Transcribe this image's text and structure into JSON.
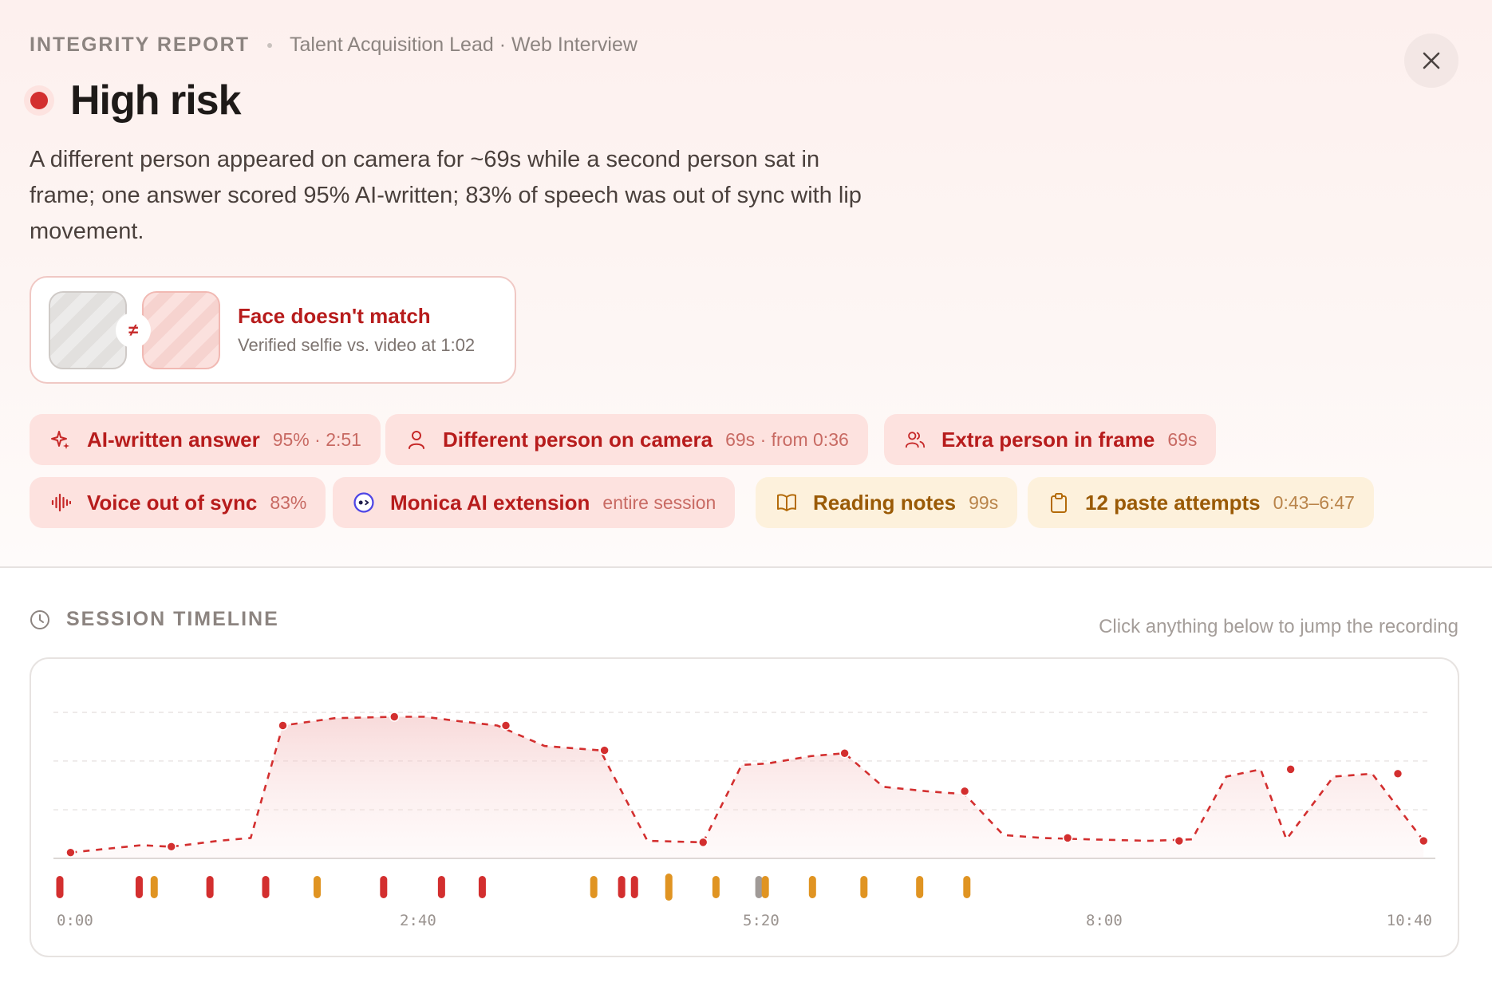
{
  "header": {
    "kicker": "INTEGRITY REPORT",
    "context": "Talent Acquisition Lead · Web Interview",
    "close_icon": "close-icon"
  },
  "risk": {
    "level": "High risk",
    "color": "#d32f2f",
    "summary": "A different person appeared on camera for ~69s while a second person sat in frame; one answer scored 95% AI-written; 83% of speech was out of sync with lip movement."
  },
  "face_match": {
    "title": "Face doesn't match",
    "subtitle": "Verified selfie vs. video at 1:02",
    "symbol": "≠"
  },
  "flags": [
    {
      "label": "AI-written answer",
      "meta": "95% · 2:51",
      "severity": "red",
      "icon": "sparkle-icon"
    },
    {
      "label": "Different person on camera",
      "meta": "69s · from 0:36",
      "severity": "red",
      "icon": "person-icon"
    },
    {
      "label": "Extra person in frame",
      "meta": "69s",
      "severity": "red",
      "icon": "people-icon"
    },
    {
      "label": "Voice out of sync",
      "meta": "83%",
      "severity": "red",
      "icon": "waveform-icon"
    },
    {
      "label": "Monica AI extension",
      "meta": "entire session",
      "severity": "red",
      "icon": "monica-icon"
    },
    {
      "label": "Reading notes",
      "meta": "99s",
      "severity": "amber",
      "icon": "book-icon"
    },
    {
      "label": "12 paste attempts",
      "meta": "0:43–6:47",
      "severity": "amber",
      "icon": "clipboard-icon"
    }
  ],
  "timeline": {
    "title": "SESSION TIMELINE",
    "hint": "Click anything below to jump the recording",
    "icon": "clock-icon"
  },
  "chart_data": {
    "type": "area",
    "x_unit": "seconds",
    "xlim": [
      0,
      640
    ],
    "ylim": [
      0,
      100
    ],
    "x_ticks": [
      {
        "value": 0,
        "label": "0:00"
      },
      {
        "value": 160,
        "label": "2:40"
      },
      {
        "value": 320,
        "label": "5:20"
      },
      {
        "value": 480,
        "label": "8:00"
      },
      {
        "value": 640,
        "label": "10:40"
      }
    ],
    "grid": true,
    "series": [
      {
        "color": "#d32f2f",
        "line_style": "dashed",
        "points": [
          [
            5,
            4
          ],
          [
            38,
            9
          ],
          [
            52,
            8
          ],
          [
            74,
            12
          ],
          [
            89,
            14
          ],
          [
            104,
            91
          ],
          [
            128,
            96
          ],
          [
            156,
            97
          ],
          [
            170,
            97
          ],
          [
            186,
            94
          ],
          [
            204,
            91
          ],
          [
            226,
            77
          ],
          [
            252,
            74
          ],
          [
            274,
            12
          ],
          [
            300,
            11
          ],
          [
            318,
            64
          ],
          [
            330,
            65
          ],
          [
            350,
            70
          ],
          [
            366,
            72
          ],
          [
            384,
            49
          ],
          [
            404,
            46
          ],
          [
            422,
            44
          ],
          [
            440,
            16
          ],
          [
            458,
            14
          ],
          [
            480,
            13
          ],
          [
            508,
            12
          ],
          [
            528,
            13
          ],
          [
            544,
            56
          ],
          [
            560,
            61
          ],
          [
            572,
            13
          ],
          [
            594,
            56
          ],
          [
            612,
            58
          ],
          [
            636,
            12
          ]
        ],
        "markers": [
          [
            5,
            4
          ],
          [
            52,
            8
          ],
          [
            104,
            91
          ],
          [
            156,
            97
          ],
          [
            208,
            91
          ],
          [
            254,
            74
          ],
          [
            300,
            11
          ],
          [
            366,
            72
          ],
          [
            422,
            46
          ],
          [
            470,
            14
          ],
          [
            522,
            12
          ],
          [
            574,
            61
          ],
          [
            624,
            58
          ],
          [
            636,
            12
          ]
        ]
      }
    ],
    "events": [
      {
        "t": 0,
        "severity": "red"
      },
      {
        "t": 37,
        "severity": "red"
      },
      {
        "t": 44,
        "severity": "amber"
      },
      {
        "t": 70,
        "severity": "red"
      },
      {
        "t": 96,
        "severity": "red"
      },
      {
        "t": 120,
        "severity": "amber"
      },
      {
        "t": 151,
        "severity": "red"
      },
      {
        "t": 178,
        "severity": "red"
      },
      {
        "t": 197,
        "severity": "red"
      },
      {
        "t": 249,
        "severity": "amber"
      },
      {
        "t": 262,
        "severity": "red"
      },
      {
        "t": 268,
        "severity": "red"
      },
      {
        "t": 284,
        "severity": "amber",
        "tall": true
      },
      {
        "t": 306,
        "severity": "amber"
      },
      {
        "t": 326,
        "severity": "grey"
      },
      {
        "t": 329,
        "severity": "amber"
      },
      {
        "t": 351,
        "severity": "amber"
      },
      {
        "t": 375,
        "severity": "amber"
      },
      {
        "t": 401,
        "severity": "amber"
      },
      {
        "t": 423,
        "severity": "amber"
      }
    ],
    "event_colors": {
      "red": "#d32f2f",
      "amber": "#e09422",
      "grey": "#a09a97"
    }
  }
}
